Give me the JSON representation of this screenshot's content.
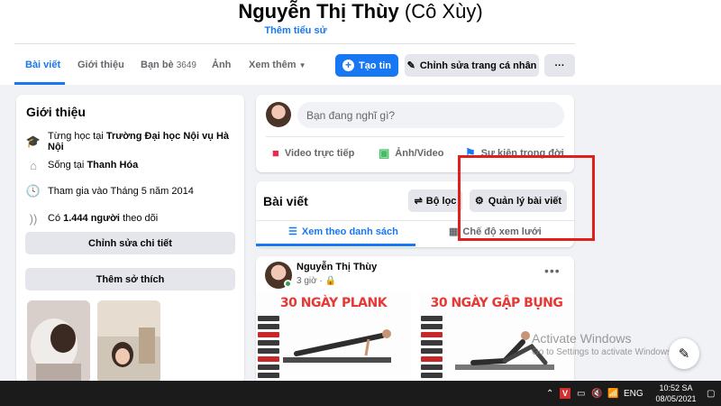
{
  "profile": {
    "name": "Nguyễn Thị Thùy",
    "nickname": "(Cô Xùy)",
    "bio_link": "Thêm tiểu sử"
  },
  "tabs": [
    {
      "label": "Bài viết",
      "active": true
    },
    {
      "label": "Giới thiệu"
    },
    {
      "label": "Bạn bè",
      "count": "3649"
    },
    {
      "label": "Ảnh"
    },
    {
      "label": "Xem thêm"
    }
  ],
  "actions": {
    "add_story": "Tạo tin",
    "edit_profile": "Chỉnh sửa trang cá nhân",
    "more": "···"
  },
  "intro": {
    "title": "Giới thiệu",
    "studied_prefix": "Từng học tại",
    "studied_school": "Trường Đại học Nội vụ Hà Nội",
    "lives_prefix": "Sống tại",
    "lives_city": "Thanh Hóa",
    "joined": "Tham gia vào Tháng 5 năm 2014",
    "followers_prefix": "Có",
    "followers_count": "1.444 người",
    "followers_suffix": "theo dõi",
    "edit_details": "Chỉnh sửa chi tiết",
    "add_hobbies": "Thêm sở thích"
  },
  "composer": {
    "placeholder": "Bạn đang nghĩ gì?",
    "live_video": "Video trực tiếp",
    "photo_video": "Ảnh/Video",
    "life_event": "Sự kiện trong đời"
  },
  "posts_section": {
    "title": "Bài viết",
    "filter": "Bộ lọc",
    "manage": "Quản lý bài viết",
    "list_view": "Xem theo danh sách",
    "grid_view": "Chế độ xem lưới"
  },
  "post": {
    "author": "Nguyễn Thị Thùy",
    "time": "3 giờ ·",
    "image_left_title": "30 NGÀY PLANK",
    "image_right_title": "30 NGÀY GẬP BỤNG"
  },
  "watermark": {
    "title": "Activate Windows",
    "subtitle": "Go to Settings to activate Windows."
  },
  "taskbar": {
    "language": "ENG",
    "time": "10:52 SA",
    "date": "08/05/2021"
  },
  "colors": {
    "brand": "#1877f2",
    "highlight": "#e0211b",
    "online": "#31a24c"
  }
}
